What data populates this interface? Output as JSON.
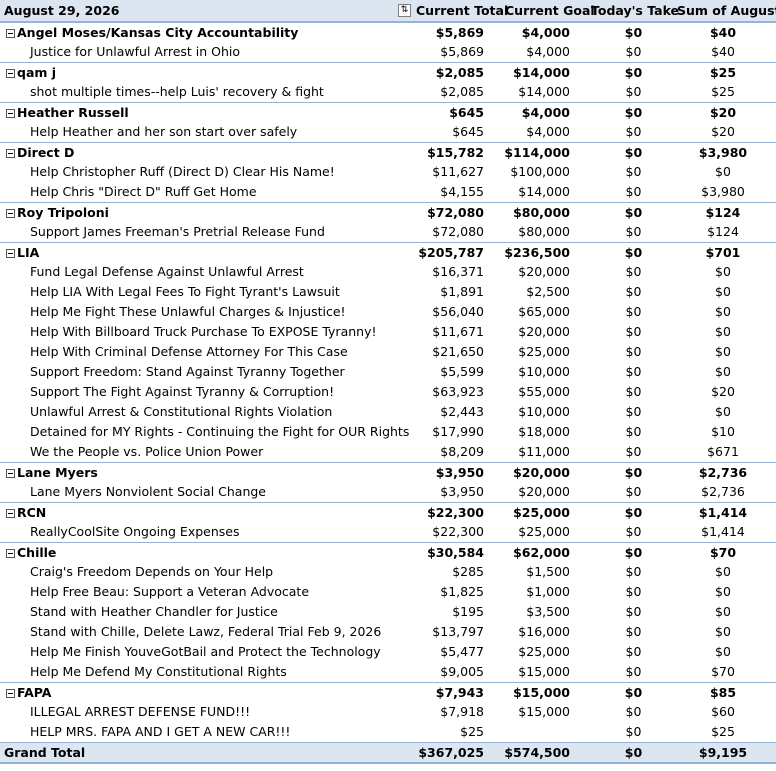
{
  "header": {
    "date": "August 29, 2026",
    "filter_icon": "sort-filter-icon",
    "columns": [
      "Current Total",
      "Current Goal",
      "Today's Take",
      "Sum of August"
    ]
  },
  "groups": [
    {
      "name": "Angel Moses/Kansas City Accountability",
      "total": "$5,869",
      "goal": "$4,000",
      "today": "$0",
      "august": "$40",
      "items": [
        {
          "name": "Justice for Unlawful Arrest in Ohio",
          "total": "$5,869",
          "goal": "$4,000",
          "today": "$0",
          "august": "$40"
        }
      ]
    },
    {
      "name": "qam j",
      "total": "$2,085",
      "goal": "$14,000",
      "today": "$0",
      "august": "$25",
      "items": [
        {
          "name": "shot multiple times--help Luis' recovery & fight",
          "total": "$2,085",
          "goal": "$14,000",
          "today": "$0",
          "august": "$25"
        }
      ]
    },
    {
      "name": "Heather Russell",
      "total": "$645",
      "goal": "$4,000",
      "today": "$0",
      "august": "$20",
      "items": [
        {
          "name": "Help Heather and her son start over safely",
          "total": "$645",
          "goal": "$4,000",
          "today": "$0",
          "august": "$20"
        }
      ]
    },
    {
      "name": "Direct D",
      "total": "$15,782",
      "goal": "$114,000",
      "today": "$0",
      "august": "$3,980",
      "items": [
        {
          "name": "Help Christopher Ruff (Direct D) Clear His Name!",
          "total": "$11,627",
          "goal": "$100,000",
          "today": "$0",
          "august": "$0"
        },
        {
          "name": "Help Chris \"Direct D\" Ruff Get Home",
          "total": "$4,155",
          "goal": "$14,000",
          "today": "$0",
          "august": "$3,980"
        }
      ]
    },
    {
      "name": "Roy Tripoloni",
      "total": "$72,080",
      "goal": "$80,000",
      "today": "$0",
      "august": "$124",
      "items": [
        {
          "name": "Support James Freeman's Pretrial Release Fund",
          "total": "$72,080",
          "goal": "$80,000",
          "today": "$0",
          "august": "$124"
        }
      ]
    },
    {
      "name": "LIA",
      "total": "$205,787",
      "goal": "$236,500",
      "today": "$0",
      "august": "$701",
      "items": [
        {
          "name": "Fund Legal Defense Against Unlawful Arrest",
          "total": "$16,371",
          "goal": "$20,000",
          "today": "$0",
          "august": "$0"
        },
        {
          "name": "Help LIA With Legal Fees To Fight Tyrant's Lawsuit",
          "total": "$1,891",
          "goal": "$2,500",
          "today": "$0",
          "august": "$0"
        },
        {
          "name": "Help Me Fight These Unlawful Charges & Injustice!",
          "total": "$56,040",
          "goal": "$65,000",
          "today": "$0",
          "august": "$0"
        },
        {
          "name": "Help With Billboard Truck Purchase To EXPOSE Tyranny!",
          "total": "$11,671",
          "goal": "$20,000",
          "today": "$0",
          "august": "$0"
        },
        {
          "name": "Help With Criminal Defense Attorney For This Case",
          "total": "$21,650",
          "goal": "$25,000",
          "today": "$0",
          "august": "$0"
        },
        {
          "name": "Support Freedom: Stand Against Tyranny Together",
          "total": "$5,599",
          "goal": "$10,000",
          "today": "$0",
          "august": "$0"
        },
        {
          "name": "Support The Fight Against Tyranny & Corruption!",
          "total": "$63,923",
          "goal": "$55,000",
          "today": "$0",
          "august": "$20"
        },
        {
          "name": "Unlawful Arrest & Constitutional Rights Violation",
          "total": "$2,443",
          "goal": "$10,000",
          "today": "$0",
          "august": "$0"
        },
        {
          "name": "Detained for MY Rights - Continuing the Fight for OUR Rights",
          "total": "$17,990",
          "goal": "$18,000",
          "today": "$0",
          "august": "$10"
        },
        {
          "name": "We the People vs. Police Union Power",
          "total": "$8,209",
          "goal": "$11,000",
          "today": "$0",
          "august": "$671"
        }
      ]
    },
    {
      "name": "Lane Myers",
      "total": "$3,950",
      "goal": "$20,000",
      "today": "$0",
      "august": "$2,736",
      "items": [
        {
          "name": "Lane Myers Nonviolent Social Change",
          "total": "$3,950",
          "goal": "$20,000",
          "today": "$0",
          "august": "$2,736"
        }
      ]
    },
    {
      "name": "RCN",
      "total": "$22,300",
      "goal": "$25,000",
      "today": "$0",
      "august": "$1,414",
      "items": [
        {
          "name": "ReallyCoolSite Ongoing Expenses",
          "total": "$22,300",
          "goal": "$25,000",
          "today": "$0",
          "august": "$1,414"
        }
      ]
    },
    {
      "name": "Chille",
      "total": "$30,584",
      "goal": "$62,000",
      "today": "$0",
      "august": "$70",
      "items": [
        {
          "name": "Craig's Freedom Depends on Your Help",
          "total": "$285",
          "goal": "$1,500",
          "today": "$0",
          "august": "$0"
        },
        {
          "name": "Help Free Beau: Support a Veteran Advocate",
          "total": "$1,825",
          "goal": "$1,000",
          "today": "$0",
          "august": "$0"
        },
        {
          "name": "Stand with Heather Chandler for Justice",
          "total": "$195",
          "goal": "$3,500",
          "today": "$0",
          "august": "$0"
        },
        {
          "name": "Stand with Chille, Delete Lawz, Federal Trial Feb 9, 2026",
          "total": "$13,797",
          "goal": "$16,000",
          "today": "$0",
          "august": "$0"
        },
        {
          "name": "Help Me Finish YouveGotBail and Protect the Technology",
          "total": "$5,477",
          "goal": "$25,000",
          "today": "$0",
          "august": "$0"
        },
        {
          "name": "Help Me Defend My Constitutional Rights",
          "total": "$9,005",
          "goal": "$15,000",
          "today": "$0",
          "august": "$70"
        }
      ]
    },
    {
      "name": "FAPA",
      "total": "$7,943",
      "goal": "$15,000",
      "today": "$0",
      "august": "$85",
      "items": [
        {
          "name": "ILLEGAL ARREST DEFENSE FUND!!!",
          "total": "$7,918",
          "goal": "$15,000",
          "today": "$0",
          "august": "$60"
        },
        {
          "name": "HELP MRS. FAPA AND I GET A NEW CAR!!!",
          "total": "$25",
          "goal": "",
          "today": "$0",
          "august": "$25"
        }
      ]
    }
  ],
  "grand_total": {
    "label": "Grand Total",
    "total": "$367,025",
    "goal": "$574,500",
    "today": "$0",
    "august": "$9,195"
  }
}
